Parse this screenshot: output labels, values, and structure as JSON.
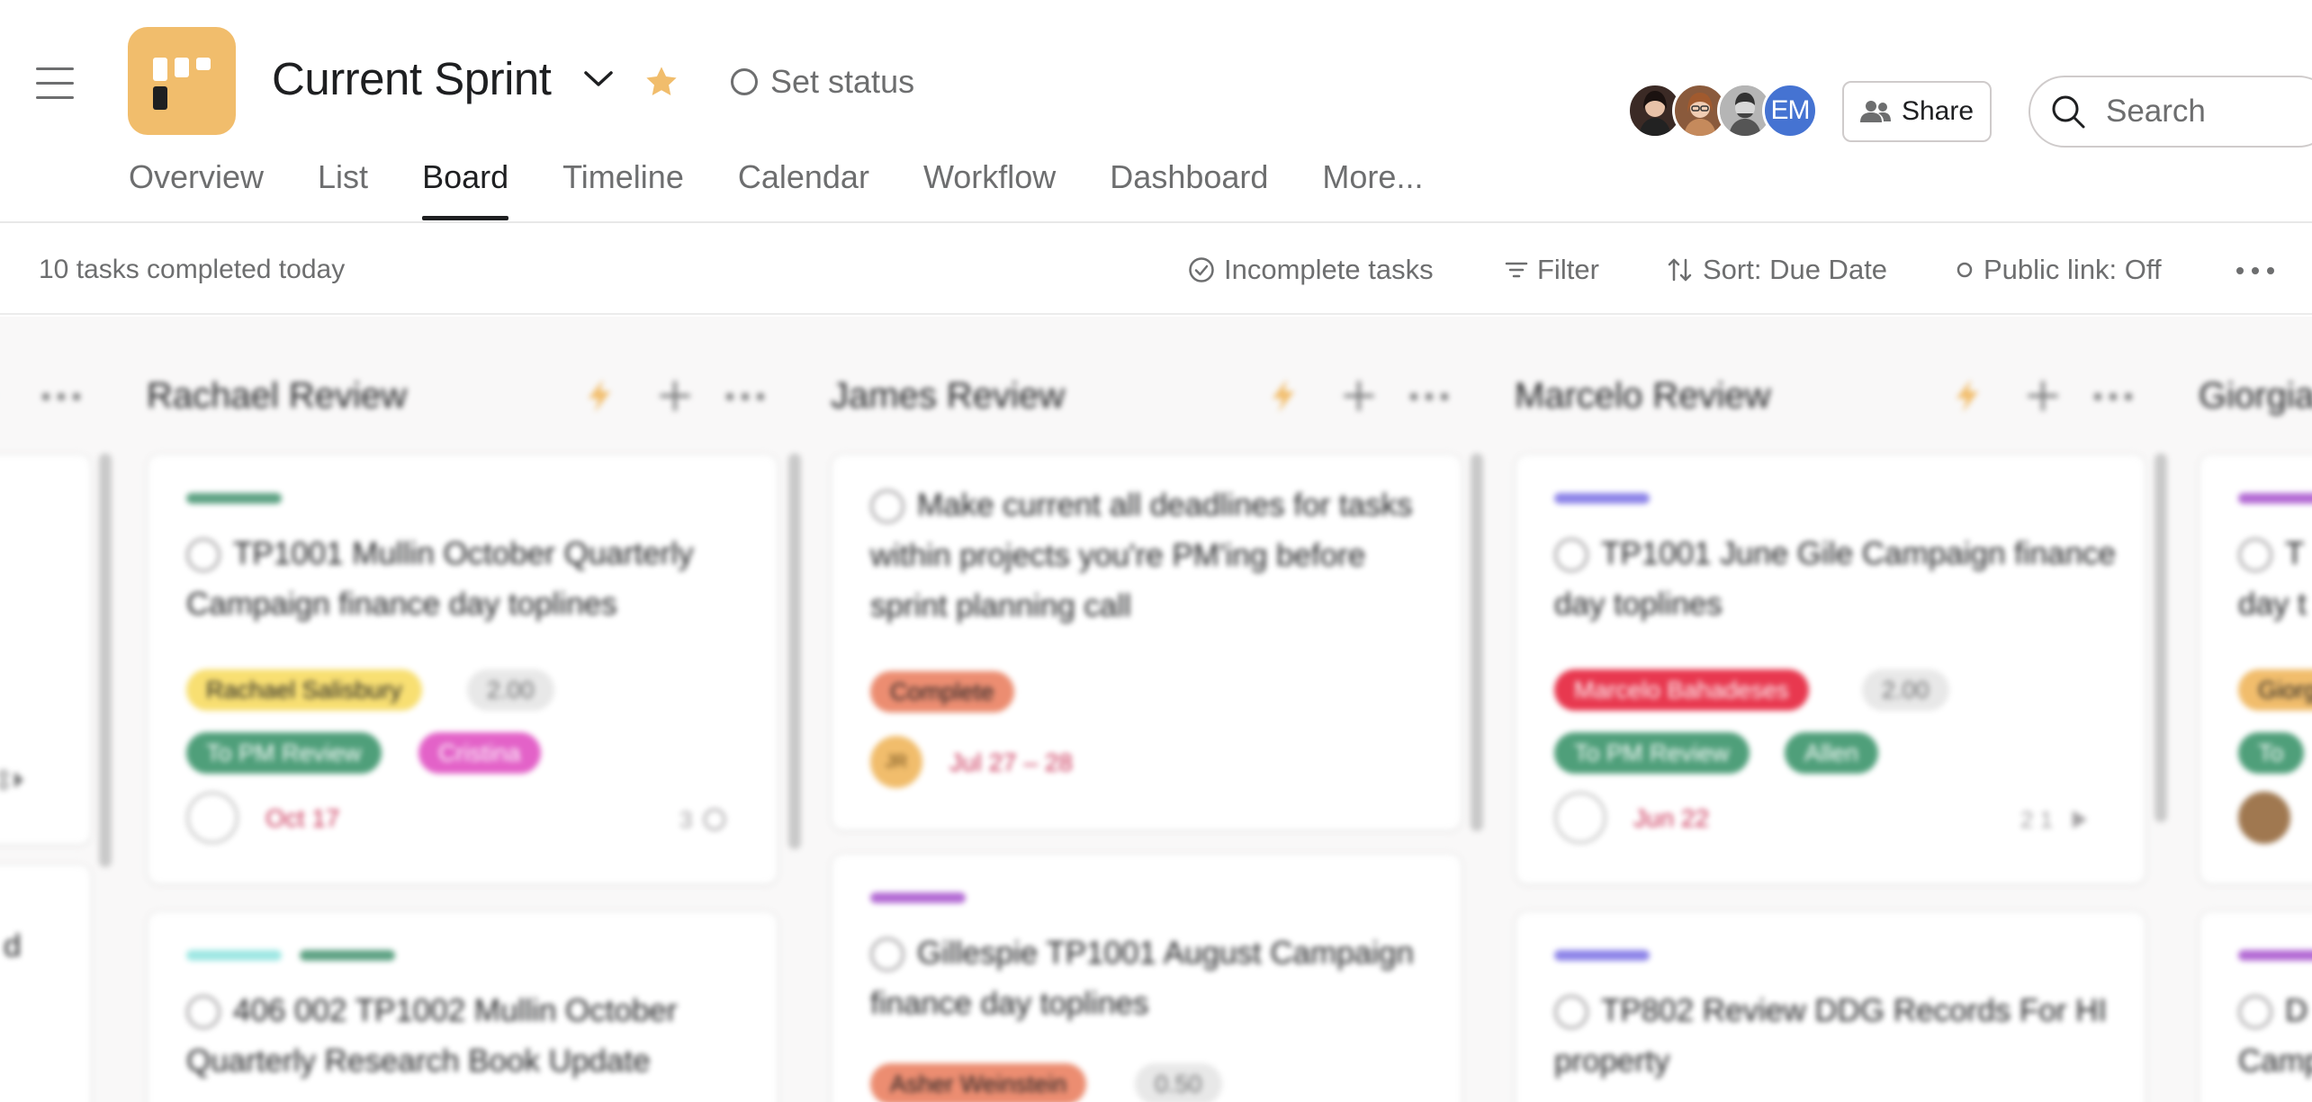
{
  "header": {
    "title": "Current Sprint",
    "set_status_label": "Set status",
    "share_label": "Share",
    "search_placeholder": "Search",
    "avatar_initials": "EM",
    "project_color": "#f1bd6c",
    "tabs": [
      "Overview",
      "List",
      "Board",
      "Timeline",
      "Calendar",
      "Workflow",
      "Dashboard",
      "More..."
    ],
    "active_tab": "Board"
  },
  "toolbar": {
    "completed_text": "10 tasks completed today",
    "incomplete_label": "Incomplete tasks",
    "filter_label": "Filter",
    "sort_label": "Sort: Due Date",
    "public_link_label": "Public link: Off"
  },
  "board": {
    "columns": [
      {
        "title": "Rachael Review",
        "cards": [
          {
            "task": "TP1001 Mullin October Quarterly Campaign finance day toplines",
            "tags": [
              "Rachael Salisbury",
              "2.00",
              "To PM Review",
              "Cristina"
            ],
            "date": "Oct 17",
            "meta": "3"
          },
          {
            "task": "406 002 TP1002 Mullin October Quarterly Research Book Update"
          }
        ]
      },
      {
        "title": "James Review",
        "cards": [
          {
            "task": "Make current all deadlines for tasks within projects you're PM'ing before sprint planning call",
            "tags": [
              "Complete"
            ],
            "assignee_initials": "JR",
            "date": "Jul 27 – 28"
          },
          {
            "task": "Gillespie TP1001 August Campaign finance day toplines",
            "tags": [
              "Asher Weinstein",
              "0.50"
            ]
          }
        ]
      },
      {
        "title": "Marcelo Review",
        "cards": [
          {
            "task": "TP1001 June Gile Campaign finance day toplines",
            "tags": [
              "Marcelo Bahadeses",
              "2.00",
              "To PM Review",
              "Allen"
            ],
            "date": "Jun 22",
            "meta": "2 1"
          },
          {
            "task": "TP802 Review DDG Records For HI property"
          }
        ]
      },
      {
        "title": "Giorgia",
        "cards": [
          {
            "task": "T day t",
            "tags": [
              "Giorg",
              "To"
            ]
          },
          {
            "task": "D Camp"
          }
        ]
      }
    ],
    "left_column_fragment": "d"
  },
  "colors": {
    "tag_yellow": "#f8df72",
    "tag_green": "#4f9f7a",
    "tag_pink": "#e362c8",
    "tag_orange": "#ec8d71",
    "tag_red": "#e8384f",
    "tag_amber": "#f1bd6c",
    "stripe_green": "#5da283",
    "stripe_teal": "#9ee7e3",
    "stripe_indigo": "#8d84e8",
    "stripe_purple": "#b36bd4",
    "due_red": "#c92f54"
  }
}
